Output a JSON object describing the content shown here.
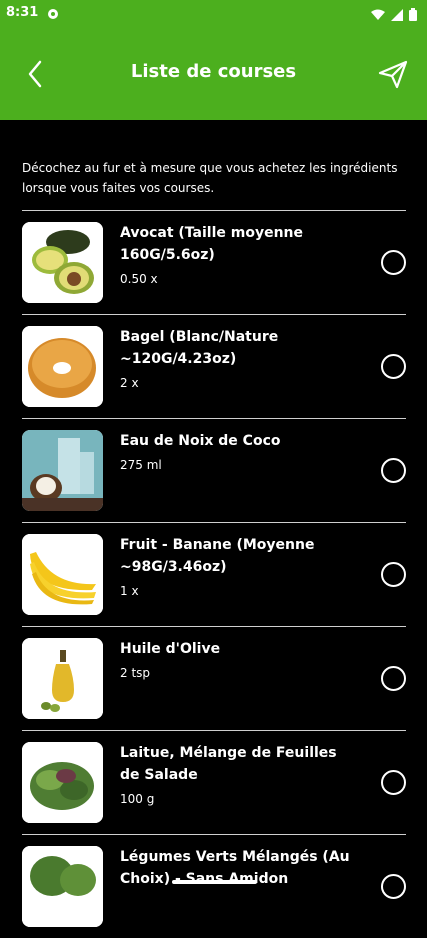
{
  "status": {
    "time": "8:31"
  },
  "header": {
    "title": "Liste de courses"
  },
  "intro": "Décochez au fur et à mesure que vous achetez les ingrédients lorsque vous faites vos courses.",
  "items": [
    {
      "name": "Avocat (Taille moyenne 160G/5.6oz)",
      "qty": "0.50 x",
      "icon": "avocado"
    },
    {
      "name": "Bagel (Blanc/Nature ~120G/4.23oz)",
      "qty": "2 x",
      "icon": "bagel"
    },
    {
      "name": "Eau de Noix de Coco",
      "qty": "275 ml",
      "icon": "coconut-water"
    },
    {
      "name": "Fruit - Banane (Moyenne ~98G/3.46oz)",
      "qty": "1 x",
      "icon": "banana"
    },
    {
      "name": "Huile d'Olive",
      "qty": "2 tsp",
      "icon": "olive-oil"
    },
    {
      "name": "Laitue, Mélange de Feuilles de Salade",
      "qty": "100 g",
      "icon": "lettuce"
    },
    {
      "name": "Légumes Verts Mélangés (Au Choix) - Sans Amidon",
      "qty": "",
      "icon": "greens"
    }
  ],
  "colors": {
    "appbar": "#4caf1e",
    "background": "#000000"
  }
}
